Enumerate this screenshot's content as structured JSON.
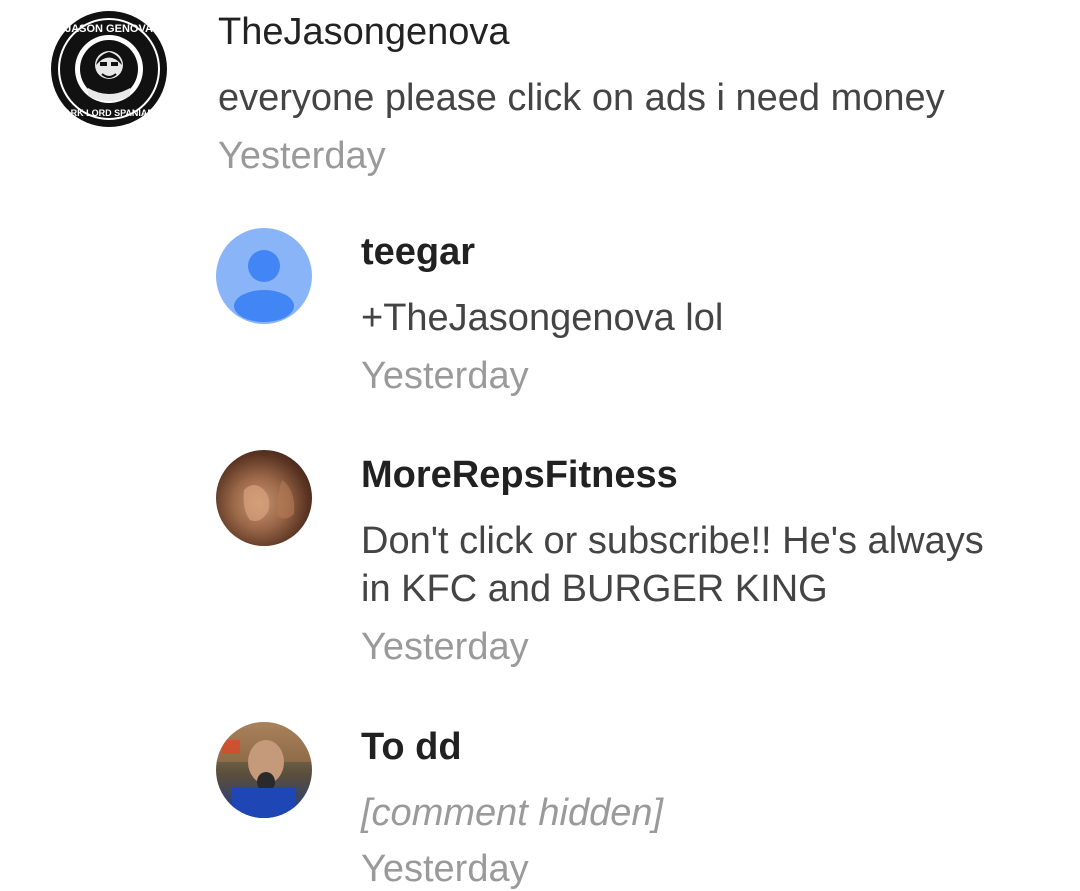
{
  "comments": [
    {
      "author": "TheJasongenova",
      "text": "everyone please click on ads i need money",
      "time": "Yesterday",
      "avatar_badge_top": "JASON GENOVA",
      "avatar_badge_bottom": "DARK LORD SPANIARD"
    }
  ],
  "replies": [
    {
      "author": "teegar",
      "text": "+TheJasongenova lol",
      "time": "Yesterday",
      "avatar_color": "#8AB4F8"
    },
    {
      "author": "MoreRepsFitness",
      "text": "Don't click or subscribe!! He's always in KFC and BURGER KING",
      "time": "Yesterday"
    },
    {
      "author": "To dd",
      "text": "[comment hidden]",
      "time": "Yesterday"
    }
  ]
}
